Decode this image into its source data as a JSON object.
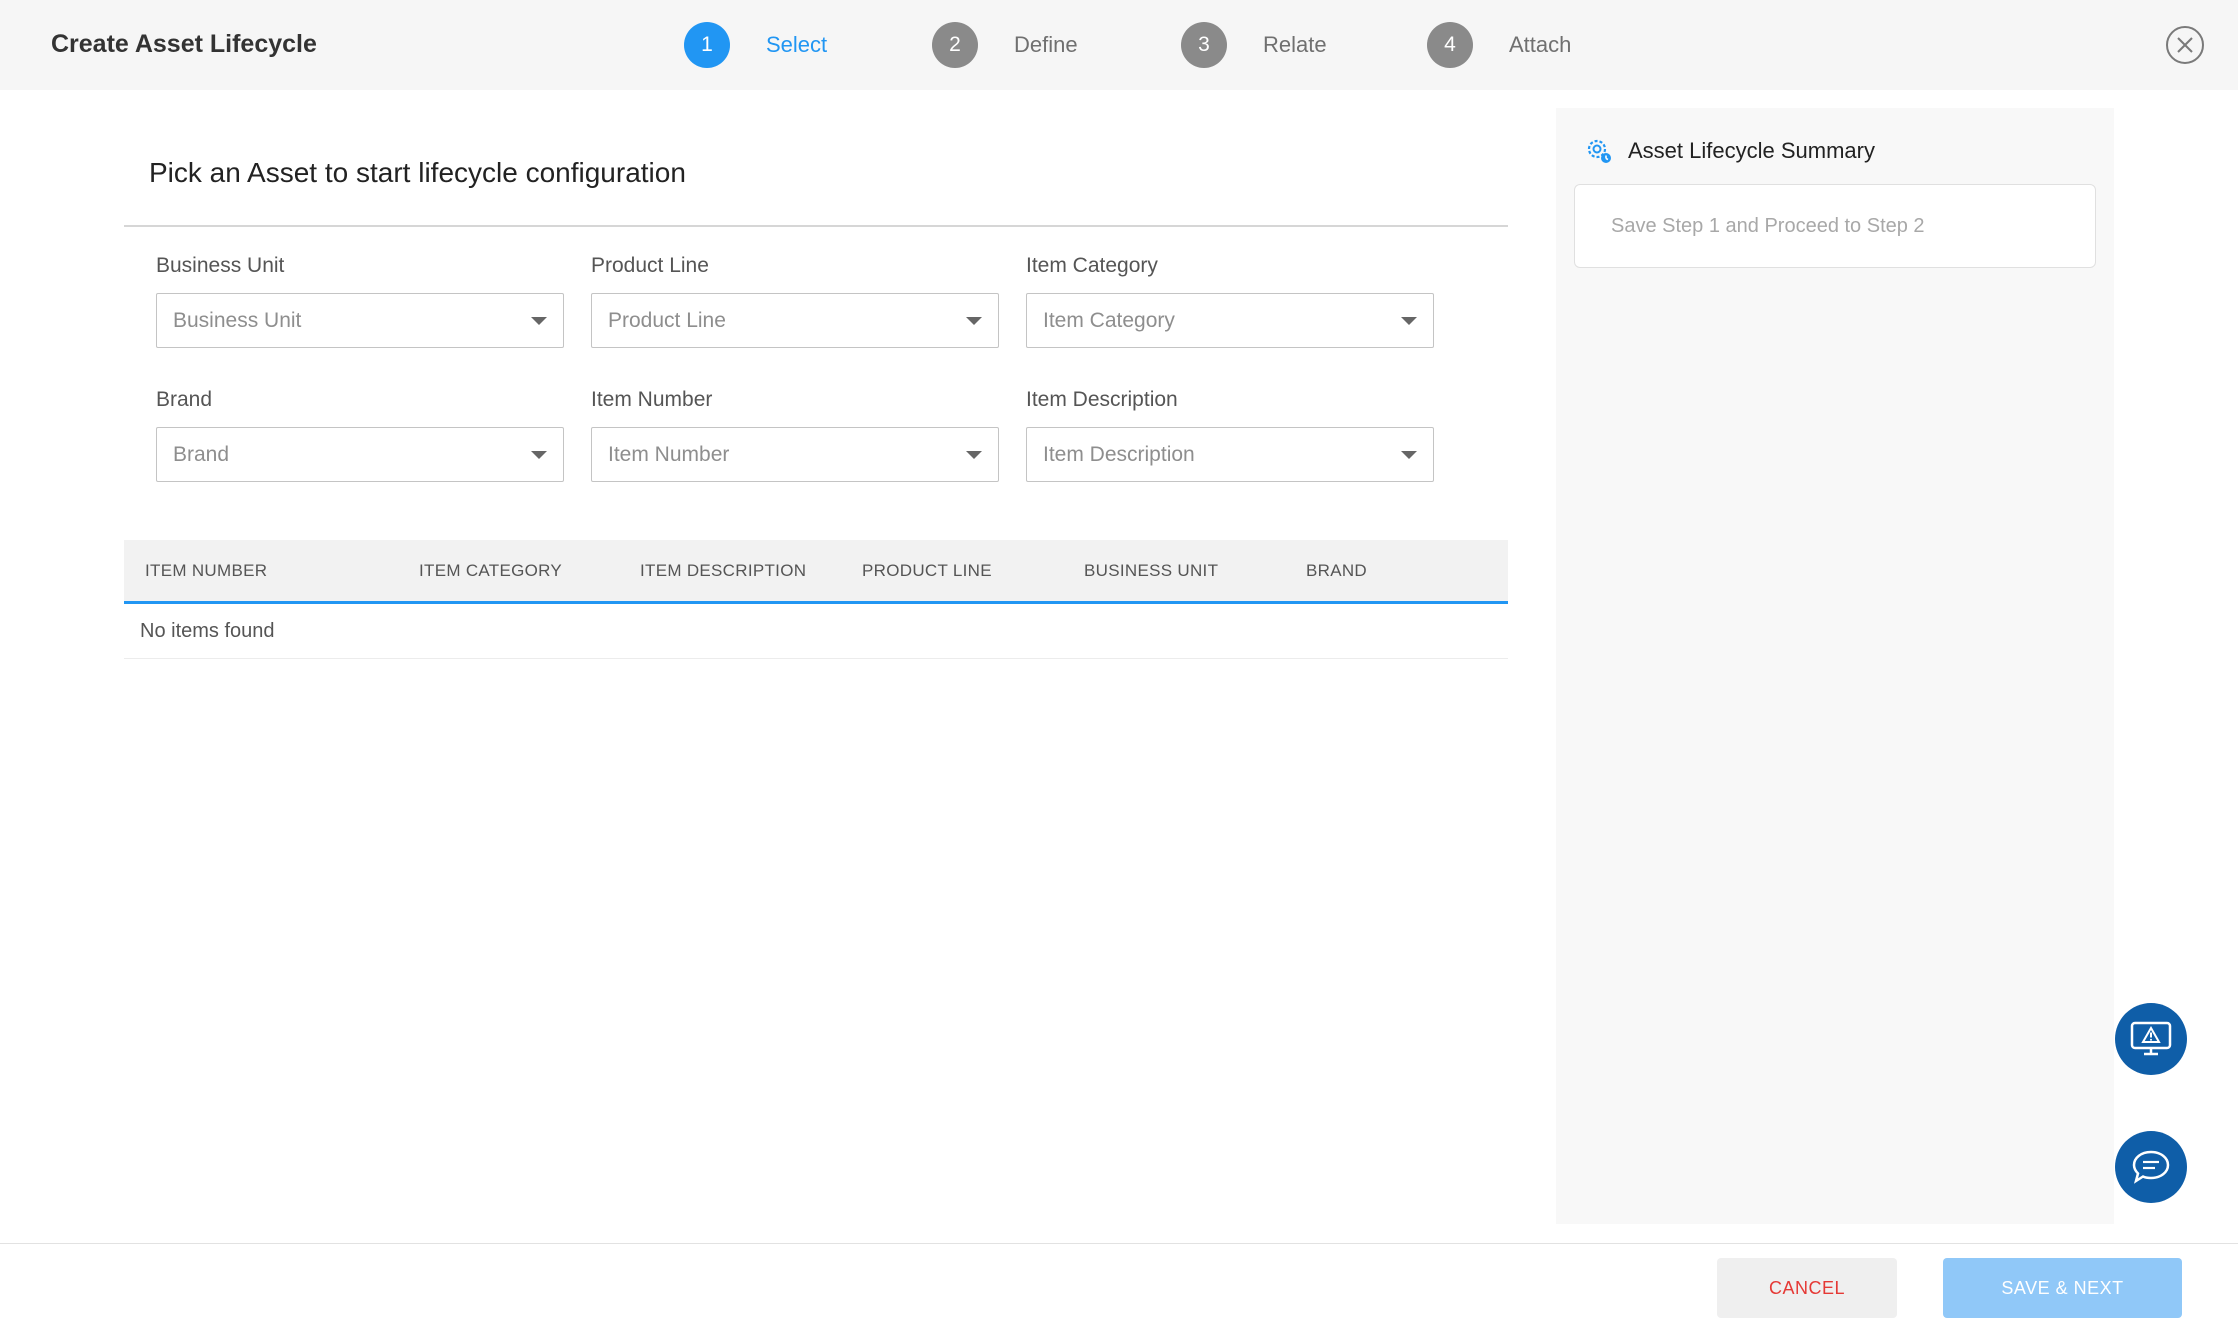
{
  "header": {
    "title": "Create Asset Lifecycle",
    "steps": [
      {
        "number": "1",
        "label": "Select",
        "active": true
      },
      {
        "number": "2",
        "label": "Define",
        "active": false
      },
      {
        "number": "3",
        "label": "Relate",
        "active": false
      },
      {
        "number": "4",
        "label": "Attach",
        "active": false
      }
    ],
    "close_icon": "close-circle-icon"
  },
  "main": {
    "title": "Pick an Asset to start lifecycle configuration",
    "filters": [
      {
        "label": "Business Unit",
        "placeholder": "Business Unit"
      },
      {
        "label": "Product Line",
        "placeholder": "Product Line"
      },
      {
        "label": "Item Category",
        "placeholder": "Item Category"
      },
      {
        "label": "Brand",
        "placeholder": "Brand"
      },
      {
        "label": "Item Number",
        "placeholder": "Item Number"
      },
      {
        "label": "Item Description",
        "placeholder": "Item Description"
      }
    ],
    "table": {
      "columns": [
        "ITEM NUMBER",
        "ITEM CATEGORY",
        "ITEM DESCRIPTION",
        "PRODUCT LINE",
        "BUSINESS UNIT",
        "BRAND"
      ],
      "empty_message": "No items found"
    }
  },
  "summary": {
    "icon": "gear-cog-icon",
    "title": "Asset Lifecycle Summary",
    "message": "Save Step 1 and Proceed to Step 2"
  },
  "fabs": {
    "report_icon": "monitor-warning-icon",
    "chat_icon": "chat-bubble-icon"
  },
  "footer": {
    "cancel_label": "CANCEL",
    "save_label": "SAVE & NEXT"
  },
  "colors": {
    "accent": "#2196f3",
    "fab": "#0f5ea8",
    "cancel_text": "#e53935",
    "save_disabled": "#90c8f8"
  }
}
